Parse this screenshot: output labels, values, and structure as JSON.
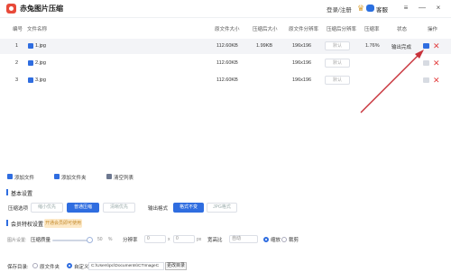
{
  "titlebar": {
    "app_title": "赤兔图片压缩",
    "login_label": "登录/注册",
    "service_label": "客服",
    "buttons": [
      "≡",
      "—",
      "×"
    ]
  },
  "table": {
    "headers": {
      "index": "编号",
      "filename": "文件名称",
      "orig_size": "原文件大小",
      "comp_size": "压缩后大小",
      "orig_res": "原文件分辨率",
      "comp_res": "压缩后分辨率",
      "ratio": "压缩率",
      "status": "状态",
      "action": "操作"
    },
    "rows": [
      {
        "index": "1",
        "filename": "1.jpg",
        "orig_size": "112.60KB",
        "comp_size": "1.99KB",
        "orig_res": "196x196",
        "comp_res": "默认",
        "ratio": "1.76%",
        "status": "输出完成"
      },
      {
        "index": "2",
        "filename": "2.jpg",
        "orig_size": "112.60KB",
        "comp_size": "",
        "orig_res": "196x196",
        "comp_res": "默认",
        "ratio": "",
        "status": ""
      },
      {
        "index": "3",
        "filename": "3.jpg",
        "orig_size": "112.60KB",
        "comp_size": "",
        "orig_res": "196x196",
        "comp_res": "默认",
        "ratio": "",
        "status": ""
      }
    ]
  },
  "toolbar": {
    "add_file": "添加文件",
    "add_folder": "添加文件夹",
    "clear_list": "清空列表"
  },
  "basic_settings": {
    "title": "基本设置",
    "compress_label": "压缩选项",
    "compress_options": [
      "缩小优先",
      "普通压缩",
      "清晰优先"
    ],
    "compress_selected": "普通压缩",
    "format_label": "输出格式",
    "format_options": [
      "格式不变",
      "JPG格式"
    ],
    "format_selected": "格式不变"
  },
  "vip_settings": {
    "title": "会员特权设置",
    "badge": "开通会员即可使用",
    "image_settings_label": "图片设置:",
    "quality_label": "压缩质量",
    "quality_value": "50",
    "quality_unit": "%",
    "resolution_label": "分辨率",
    "width_value": "0",
    "size_x": "x",
    "height_value": "0",
    "size_unit": "px",
    "aspect_label": "宽高比",
    "aspect_value": "自动",
    "mode_options": [
      "缩放",
      "裁剪"
    ],
    "mode_selected": "缩放"
  },
  "save": {
    "label": "保存目录:",
    "options": [
      "原文件夹",
      "自定义"
    ],
    "selected": "自定义",
    "path": "C:\\Users\\pc\\Documents\\CTImageC",
    "change_button": "更改目录"
  },
  "colors": {
    "accent": "#2f6de0",
    "delete": "#e23b3b",
    "arrow": "#c8313a"
  }
}
